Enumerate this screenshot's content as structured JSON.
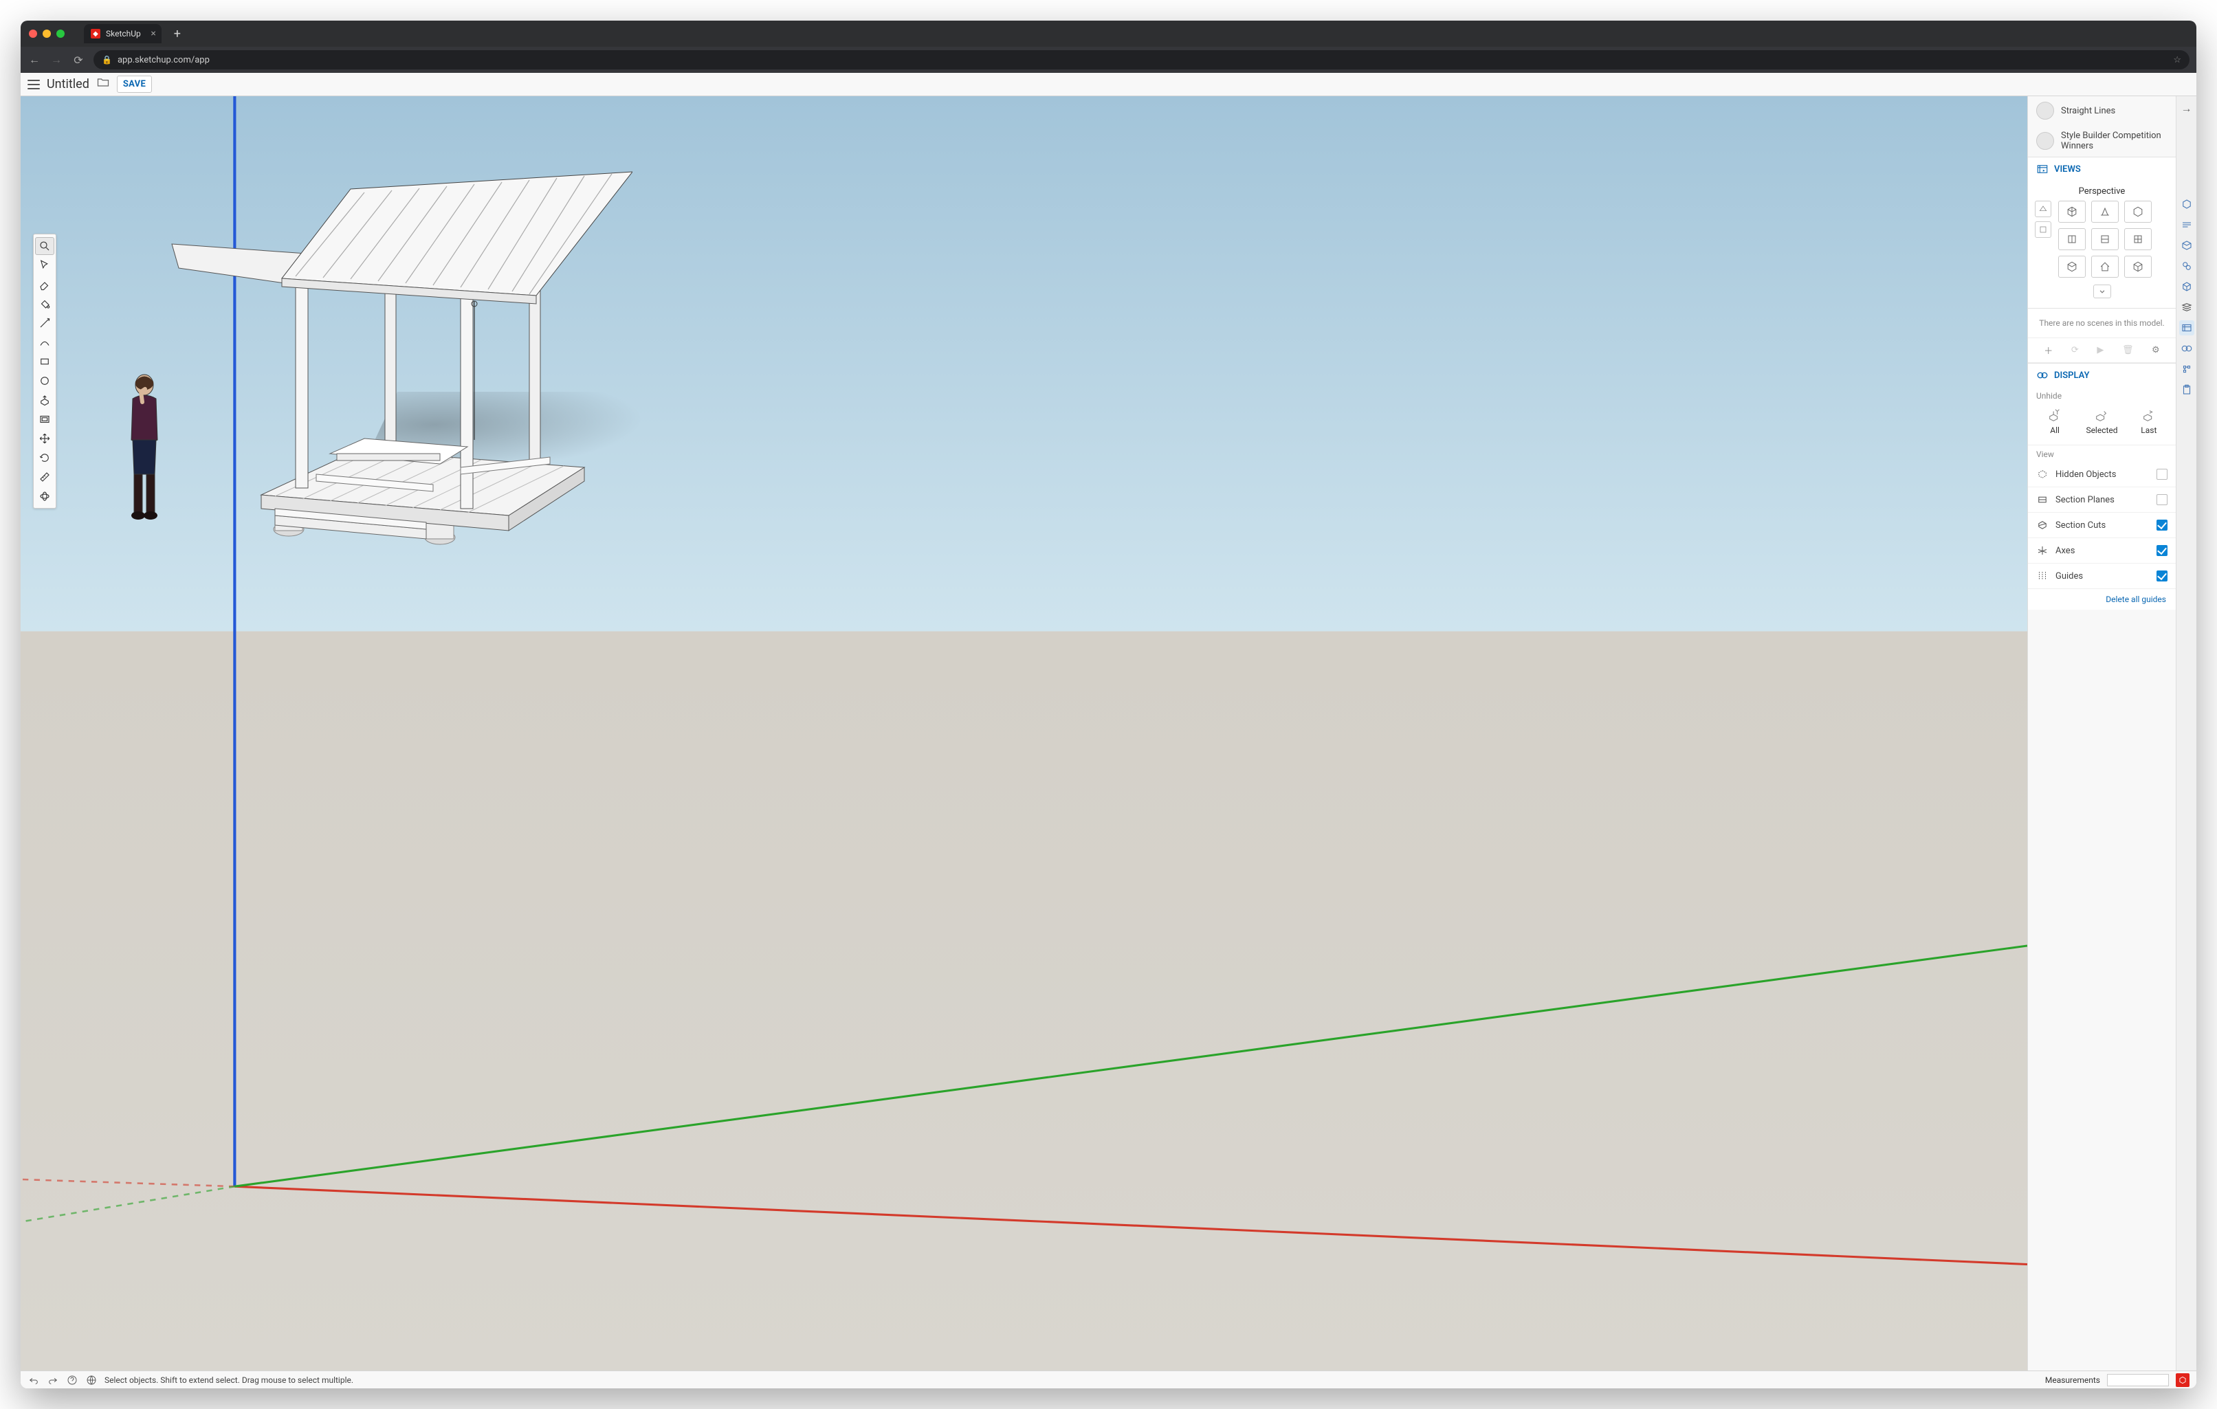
{
  "browser": {
    "tab_title": "SketchUp",
    "url": "app.sketchup.com/app"
  },
  "header": {
    "doc_title": "Untitled",
    "save_label": "SAVE"
  },
  "left_toolbar": [
    {
      "name": "search-tool",
      "active": true
    },
    {
      "name": "select-tool"
    },
    {
      "name": "eraser-tool"
    },
    {
      "name": "paint-bucket-tool"
    },
    {
      "name": "line-tool"
    },
    {
      "name": "arc-tool"
    },
    {
      "name": "rectangle-tool"
    },
    {
      "name": "circle-tool"
    },
    {
      "name": "push-pull-tool"
    },
    {
      "name": "offset-tool"
    },
    {
      "name": "move-tool"
    },
    {
      "name": "rotate-tool"
    },
    {
      "name": "tape-measure-tool"
    },
    {
      "name": "orbit-tool"
    }
  ],
  "side": {
    "styles": {
      "items": [
        {
          "label": "Straight Lines"
        },
        {
          "label": "Style Builder Competition Winners"
        }
      ]
    },
    "views": {
      "title": "VIEWS",
      "perspective_label": "Perspective",
      "no_scenes_text": "There are no scenes in this model."
    },
    "display": {
      "title": "DISPLAY",
      "unhide_label": "Unhide",
      "unhide_options": {
        "all": "All",
        "selected": "Selected",
        "last": "Last"
      },
      "view_label": "View",
      "options": [
        {
          "label": "Hidden Objects",
          "checked": false
        },
        {
          "label": "Section Planes",
          "checked": false
        },
        {
          "label": "Section Cuts",
          "checked": true
        },
        {
          "label": "Axes",
          "checked": true
        },
        {
          "label": "Guides",
          "checked": true
        }
      ],
      "delete_guides_label": "Delete all guides"
    }
  },
  "status": {
    "hint": "Select objects. Shift to extend select. Drag mouse to select multiple.",
    "measurements_label": "Measurements"
  },
  "colors": {
    "accent": "#0a67b2",
    "checkbox_on": "#0a84d6",
    "su_red": "#e2231a"
  }
}
